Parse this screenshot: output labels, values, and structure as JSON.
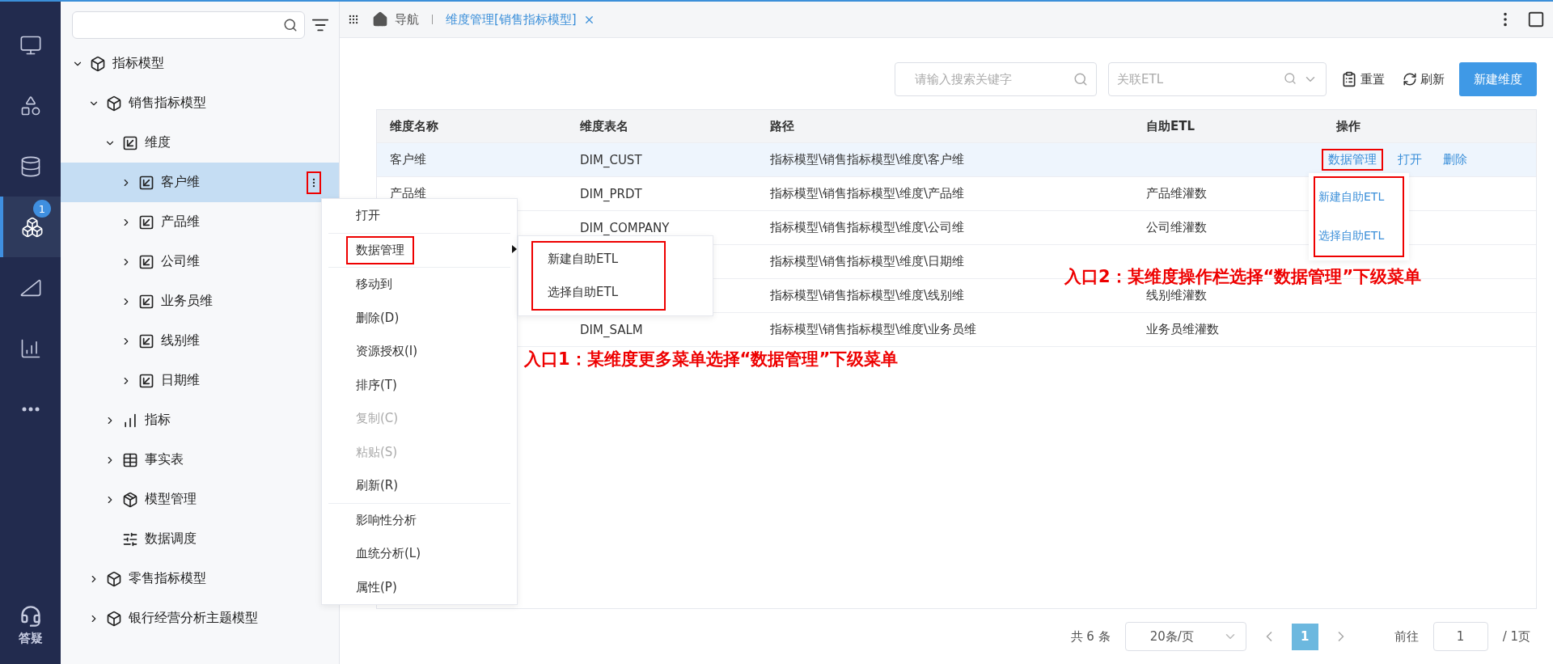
{
  "nav_rail": {
    "items": [
      {
        "kind": "monitor",
        "selected": false
      },
      {
        "kind": "apps",
        "selected": false
      },
      {
        "kind": "database",
        "selected": false
      },
      {
        "kind": "model",
        "selected": true,
        "badge": "1"
      },
      {
        "kind": "ruler",
        "selected": false
      },
      {
        "kind": "chart",
        "selected": false
      },
      {
        "kind": "more",
        "selected": false
      }
    ],
    "help_label": "答疑"
  },
  "tree": {
    "children": [
      {
        "label": "指标模型",
        "kind": "model",
        "expanded": true,
        "selected": false,
        "children": [
          {
            "label": "销售指标模型",
            "kind": "model",
            "expanded": true,
            "selected": false,
            "children": [
              {
                "label": "维度",
                "kind": "dimension",
                "expanded": true,
                "selected": false,
                "children": [
                  {
                    "label": "客户维",
                    "kind": "dimension",
                    "expanded": false,
                    "selected": true,
                    "has_children": true
                  },
                  {
                    "label": "产品维",
                    "kind": "dimension",
                    "expanded": false,
                    "selected": false,
                    "has_children": true
                  },
                  {
                    "label": "公司维",
                    "kind": "dimension",
                    "expanded": false,
                    "selected": false,
                    "has_children": true
                  },
                  {
                    "label": "业务员维",
                    "kind": "dimension",
                    "expanded": false,
                    "selected": false,
                    "has_children": true
                  },
                  {
                    "label": "线别维",
                    "kind": "dimension",
                    "expanded": false,
                    "selected": false,
                    "has_children": true
                  },
                  {
                    "label": "日期维",
                    "kind": "dimension",
                    "expanded": false,
                    "selected": false,
                    "has_children": true
                  }
                ]
              },
              {
                "label": "指标",
                "kind": "metric",
                "expanded": false,
                "selected": false,
                "has_children": true
              },
              {
                "label": "事实表",
                "kind": "fact",
                "expanded": false,
                "selected": false,
                "has_children": true
              },
              {
                "label": "模型管理",
                "kind": "manage",
                "expanded": false,
                "selected": false,
                "has_children": true
              },
              {
                "label": "数据调度",
                "kind": "schedule",
                "expanded": false,
                "selected": false,
                "has_children": false
              }
            ]
          },
          {
            "label": "零售指标模型",
            "kind": "model",
            "expanded": false,
            "selected": false,
            "has_children": true
          },
          {
            "label": "银行经营分析主题模型",
            "kind": "model",
            "expanded": false,
            "selected": false,
            "has_children": true
          }
        ]
      }
    ]
  },
  "tabs": [
    {
      "label": "导航",
      "kind": "home",
      "selected": false
    },
    {
      "label": "维度管理[销售指标模型]",
      "kind": "page",
      "selected": true
    }
  ],
  "toolbar": {
    "search_placeholder": "请输入搜索关键字",
    "etl_placeholder": "关联ETL",
    "reset": "重置",
    "refresh": "刷新",
    "create": "新建维度"
  },
  "table": {
    "columns": [
      "维度名称",
      "维度表名",
      "路径",
      "自助ETL",
      "操作"
    ],
    "rows": [
      {
        "name": "客户维",
        "table": "DIM_CUST",
        "path": "指标模型\\销售指标模型\\维度\\客户维",
        "selected": true,
        "actions": [
          {
            "label": "数据管理",
            "highlighted": true
          },
          {
            "label": "打开",
            "highlighted": false
          },
          {
            "label": "删除",
            "highlighted": false
          }
        ]
      },
      {
        "name": "产品维",
        "table": "DIM_PRDT",
        "path": "指标模型\\销售指标模型\\维度\\产品维",
        "etl": "产品维灌数",
        "selected": false
      },
      {
        "table": "DIM_COMPANY",
        "path": "指标模型\\销售指标模型\\维度\\公司维",
        "etl": "公司维灌数",
        "selected": false
      },
      {
        "path": "指标模型\\销售指标模型\\维度\\日期维",
        "selected": false
      },
      {
        "path": "指标模型\\销售指标模型\\维度\\线别维",
        "etl": "线别维灌数",
        "selected": false
      },
      {
        "table": "DIM_SALM",
        "path": "指标模型\\销售指标模型\\维度\\业务员维",
        "etl": "业务员维灌数",
        "selected": false
      }
    ]
  },
  "pagination": {
    "total": "共 6 条",
    "page_size": "20条/页",
    "pages": [
      {
        "label": "1",
        "selected": true
      }
    ],
    "goto_label": "前往",
    "goto_value": "1",
    "page_count": "/ 1页"
  },
  "context_menu": {
    "items": [
      {
        "kind": "item",
        "label": "打开",
        "disabled": false,
        "highlighted": false
      },
      {
        "kind": "separator"
      },
      {
        "kind": "submenu",
        "label": "数据管理",
        "disabled": false,
        "highlighted": true
      },
      {
        "kind": "separator"
      },
      {
        "kind": "item",
        "label": "移动到",
        "disabled": false,
        "highlighted": false
      },
      {
        "kind": "item",
        "label": "删除(D)",
        "disabled": false,
        "highlighted": false
      },
      {
        "kind": "item",
        "label": "资源授权(I)",
        "disabled": false,
        "highlighted": false
      },
      {
        "kind": "item",
        "label": "排序(T)",
        "disabled": false,
        "highlighted": false
      },
      {
        "kind": "item",
        "label": "复制(C)",
        "disabled": true,
        "highlighted": false
      },
      {
        "kind": "item",
        "label": "粘贴(S)",
        "disabled": true,
        "highlighted": false
      },
      {
        "kind": "item",
        "label": "刷新(R)",
        "disabled": false,
        "highlighted": false
      },
      {
        "kind": "separator"
      },
      {
        "kind": "item",
        "label": "影响性分析",
        "disabled": false,
        "highlighted": false
      },
      {
        "kind": "item",
        "label": "血统分析(L)",
        "disabled": false,
        "highlighted": false
      },
      {
        "kind": "item",
        "label": "属性(P)",
        "disabled": false,
        "highlighted": false
      }
    ],
    "submenu": [
      "新建自助ETL",
      "选择自助ETL"
    ]
  },
  "action_menu": [
    "新建自助ETL",
    "选择自助ETL"
  ],
  "annotations": [
    "入口1：某维度更多菜单选择“数据管理”下级菜单",
    "入口2：某维度操作栏选择“数据管理”下级菜单"
  ]
}
